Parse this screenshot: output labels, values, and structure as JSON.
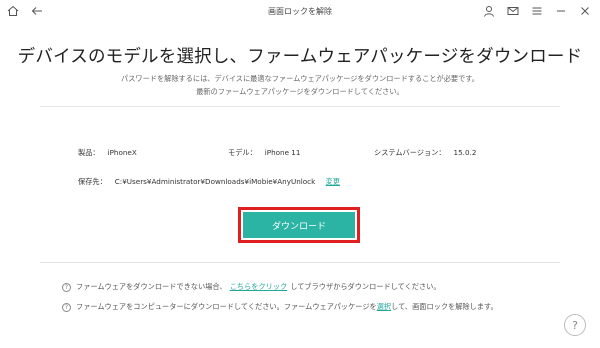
{
  "window": {
    "title": "画面ロックを解除"
  },
  "main": {
    "headline": "デバイスのモデルを選択し、ファームウェアパッケージをダウンロード",
    "subtitle_line1": "パスワードを解除するには、デバイスに最適なファームウェアパッケージをダウンロードすることが必要です。",
    "subtitle_line2": "最新のファームウェアパッケージをダウンロードしてください。"
  },
  "device_info": {
    "product_label": "製品：",
    "product_value": "iPhoneX",
    "model_label": "モデル：",
    "model_value": "iPhone 11",
    "version_label": "システムバージョン：",
    "version_value": "15.0.2",
    "save_label": "保存先：",
    "save_path": "C:¥Users¥Administrator¥Downloads¥iMobie¥AnyUnlock",
    "change_link": "変更"
  },
  "download_button": {
    "label": "ダウンロード"
  },
  "notes": {
    "note1_prefix": "ファームウェアをダウンロードできない場合、",
    "note1_link": "こちらをクリック",
    "note1_suffix": "してブラウザからダウンロードしてください。",
    "note2_prefix": "ファームウェアをコンピューターにダウンロードしてください。ファームウェアパッケージを",
    "note2_link": "選択",
    "note2_suffix": "して、画面ロックを解除します。"
  },
  "help": {
    "label": "?"
  },
  "colors": {
    "accent": "#2bb3a3",
    "highlight_border": "#e02020",
    "link": "#22a89a"
  }
}
